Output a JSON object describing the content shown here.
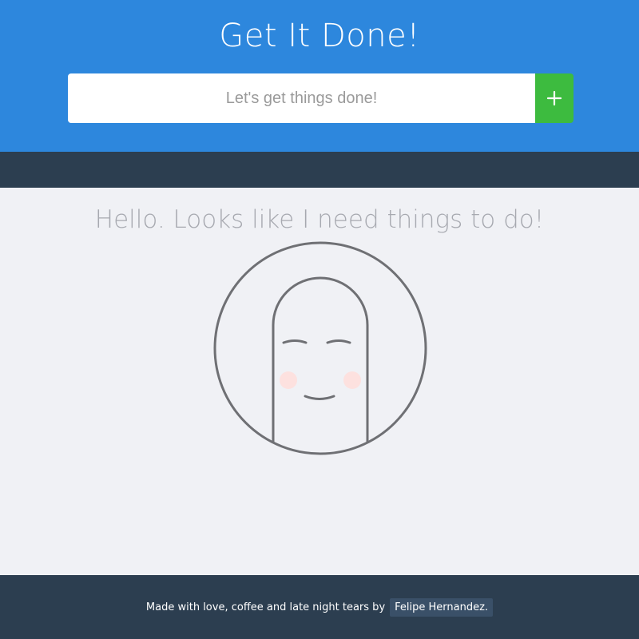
{
  "header": {
    "title": "Get It Done!",
    "input_placeholder": "Let's get things done!",
    "input_value": "",
    "add_button_icon": "plus-icon",
    "colors": {
      "background": "#2d87dd",
      "add_button": "#3dbb3f"
    }
  },
  "main": {
    "empty_message": "Hello. Looks like I need things to do!",
    "illustration_icon": "smiling-finger-face-illustration",
    "colors": {
      "background": "#f0f1f5",
      "message_text": "#a7a9b0",
      "stroke": "#6f7074",
      "cheeks": "#fde1df"
    }
  },
  "footer": {
    "text": "Made with love, coffee and late night tears by",
    "author_link": "Felipe Hernandez.",
    "colors": {
      "background": "#2c3e50",
      "link_background": "#3a5068"
    }
  }
}
